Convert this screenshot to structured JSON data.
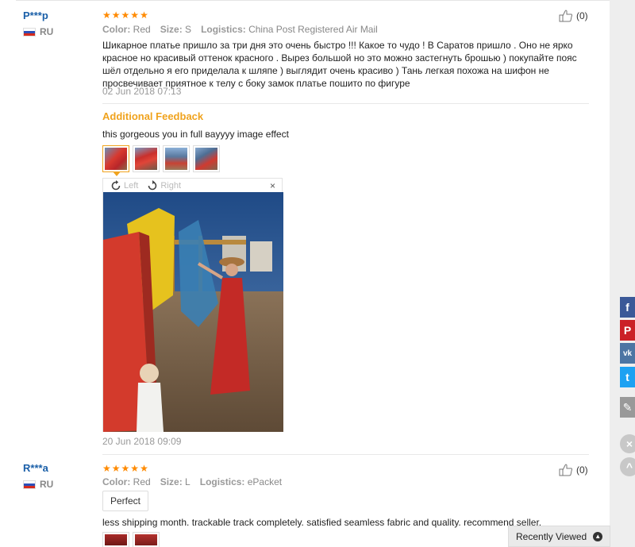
{
  "reviews": [
    {
      "user": "P***p",
      "country": "RU",
      "stars": 5,
      "helpful_count": "(0)",
      "attrs": {
        "color_label": "Color:",
        "color_value": "Red",
        "size_label": "Size:",
        "size_value": "S",
        "logistics_label": "Logistics:",
        "logistics_value": "China Post Registered Air Mail"
      },
      "text": "Шикарное платье пришло за три дня это очень быстро !!! Какое то чудо ! В Саратов пришло . Оно не ярко красное но красивый оттенок красного . Вырез большой но это можно застегнуть брошью ) покупайте пояс шёл отдельно я его приделала к шляпе ) выглядит очень красиво ) Тань легкая похожа на шифон не просвечивает приятное к телу с боку замок платье пошито по фигуре",
      "date": "02 Jun 2018 07:13",
      "additional_feedback": {
        "title": "Additional Feedback",
        "text": "this gorgeous you in full вayyyy image effect",
        "thumbnail_count": 4,
        "selected_index": 0,
        "viewer": {
          "rotate_left": "Left",
          "rotate_right": "Right",
          "close": "×"
        },
        "date": "20 Jun 2018 09:09"
      }
    },
    {
      "user": "R***a",
      "country": "RU",
      "stars": 5,
      "helpful_count": "(0)",
      "attrs": {
        "color_label": "Color:",
        "color_value": "Red",
        "size_label": "Size:",
        "size_value": "L",
        "logistics_label": "Logistics:",
        "logistics_value": "ePacket"
      },
      "tag": "Perfect",
      "text": "less shipping month. trackable track completely. satisfied seamless fabric and quality. recommend seller."
    }
  ],
  "share": {
    "facebook": "f",
    "pinterest": "P",
    "vk": "vk",
    "twitter": "t",
    "edit": "✎"
  },
  "recently_viewed": "Recently Viewed",
  "colors": {
    "star": "#ff8a00",
    "username": "#1a5fa8",
    "feedback_title": "#f0a31e",
    "facebook": "#3b5998",
    "pinterest": "#cb2027",
    "vk": "#4c75a3",
    "twitter": "#1da1f2",
    "edit": "#999999"
  }
}
